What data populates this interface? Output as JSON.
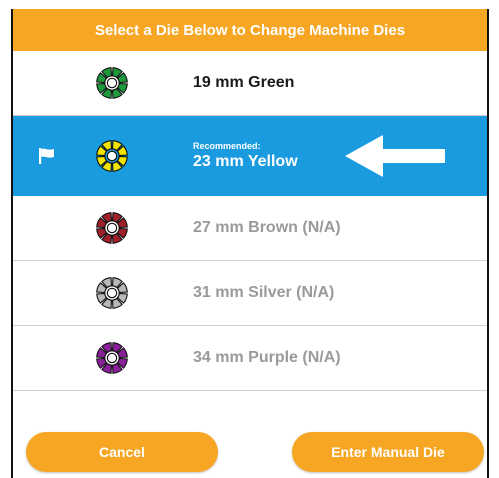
{
  "dialog": {
    "title": "Select a Die Below to Change Machine Dies"
  },
  "dies": [
    {
      "label": "19 mm Green",
      "color": "#1e9a3c",
      "available": true,
      "selected": false,
      "recommended_label": ""
    },
    {
      "label": "23 mm Yellow",
      "color": "#f2e600",
      "available": true,
      "selected": true,
      "recommended_label": "Recommended:"
    },
    {
      "label": "27 mm Brown (N/A)",
      "color": "#a0202a",
      "available": false,
      "selected": false,
      "recommended_label": ""
    },
    {
      "label": "31 mm Silver (N/A)",
      "color": "#b8b8b8",
      "available": false,
      "selected": false,
      "recommended_label": ""
    },
    {
      "label": "34 mm Purple (N/A)",
      "color": "#8a1f9a",
      "available": false,
      "selected": false,
      "recommended_label": ""
    }
  ],
  "buttons": {
    "cancel_label": "Cancel",
    "manual_label": "Enter Manual Die"
  },
  "colors": {
    "accent": "#f6a623",
    "selected_row": "#1a9be0"
  },
  "icons": {
    "flag": "flag-icon",
    "die": "die-icon",
    "arrow": "arrow-left-icon"
  }
}
